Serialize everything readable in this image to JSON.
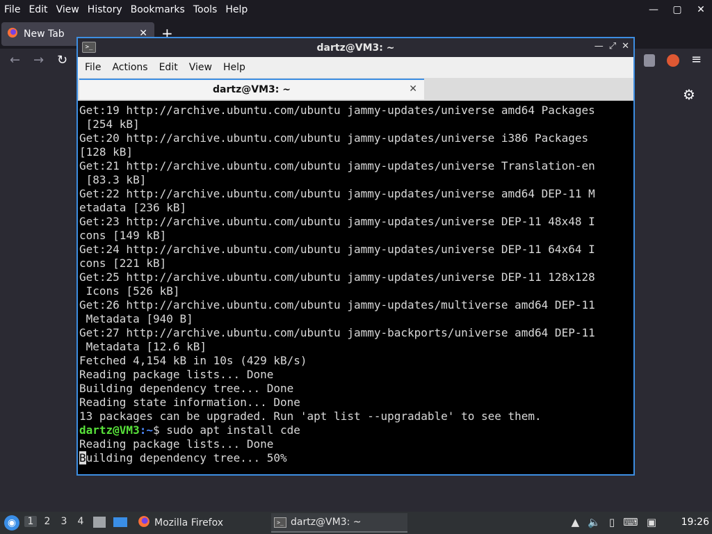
{
  "firefox": {
    "menu": [
      "File",
      "Edit",
      "View",
      "History",
      "Bookmarks",
      "Tools",
      "Help"
    ],
    "tab_title": "New Tab",
    "new_tab_symbol": "+",
    "window_controls": [
      "—",
      "▢",
      "✕"
    ],
    "icons": [
      "firefox-icon",
      "back-icon",
      "forward-icon",
      "reload-icon",
      "ublock-icon",
      "duckduckgo-icon",
      "hamburger-menu-icon",
      "gear-icon"
    ]
  },
  "terminal": {
    "window_title": "dartz@VM3: ~",
    "tab_title": "dartz@VM3: ~",
    "menu": [
      "File",
      "Actions",
      "Edit",
      "View",
      "Help"
    ],
    "lines_before": [
      "Get:19 http://archive.ubuntu.com/ubuntu jammy-updates/universe amd64 Packages",
      " [254 kB]",
      "Get:20 http://archive.ubuntu.com/ubuntu jammy-updates/universe i386 Packages",
      "[128 kB]",
      "Get:21 http://archive.ubuntu.com/ubuntu jammy-updates/universe Translation-en",
      " [83.3 kB]",
      "Get:22 http://archive.ubuntu.com/ubuntu jammy-updates/universe amd64 DEP-11 M",
      "etadata [236 kB]",
      "Get:23 http://archive.ubuntu.com/ubuntu jammy-updates/universe DEP-11 48x48 I",
      "cons [149 kB]",
      "Get:24 http://archive.ubuntu.com/ubuntu jammy-updates/universe DEP-11 64x64 I",
      "cons [221 kB]",
      "Get:25 http://archive.ubuntu.com/ubuntu jammy-updates/universe DEP-11 128x128",
      " Icons [526 kB]",
      "Get:26 http://archive.ubuntu.com/ubuntu jammy-updates/multiverse amd64 DEP-11",
      " Metadata [940 B]",
      "Get:27 http://archive.ubuntu.com/ubuntu jammy-backports/universe amd64 DEP-11",
      " Metadata [12.6 kB]",
      "Fetched 4,154 kB in 10s (429 kB/s)",
      "Reading package lists... Done",
      "Building dependency tree... Done",
      "Reading state information... Done",
      "13 packages can be upgraded. Run 'apt list --upgradable' to see them."
    ],
    "prompt_user": "dartz@VM3",
    "prompt_path": ":~",
    "command": "$ sudo apt install cde",
    "line_after": "Reading package lists... Done",
    "last_line_cursor_char": "B",
    "last_line_rest": "uilding dependency tree... 50%"
  },
  "taskbar": {
    "workspaces": [
      "1",
      "2",
      "3",
      "4"
    ],
    "active_workspace": "1",
    "tasks": [
      {
        "label": "Mozilla Firefox",
        "icon": "firefox-icon"
      },
      {
        "label": "dartz@VM3: ~",
        "icon": "terminal-icon"
      }
    ],
    "clock": "19:26"
  }
}
